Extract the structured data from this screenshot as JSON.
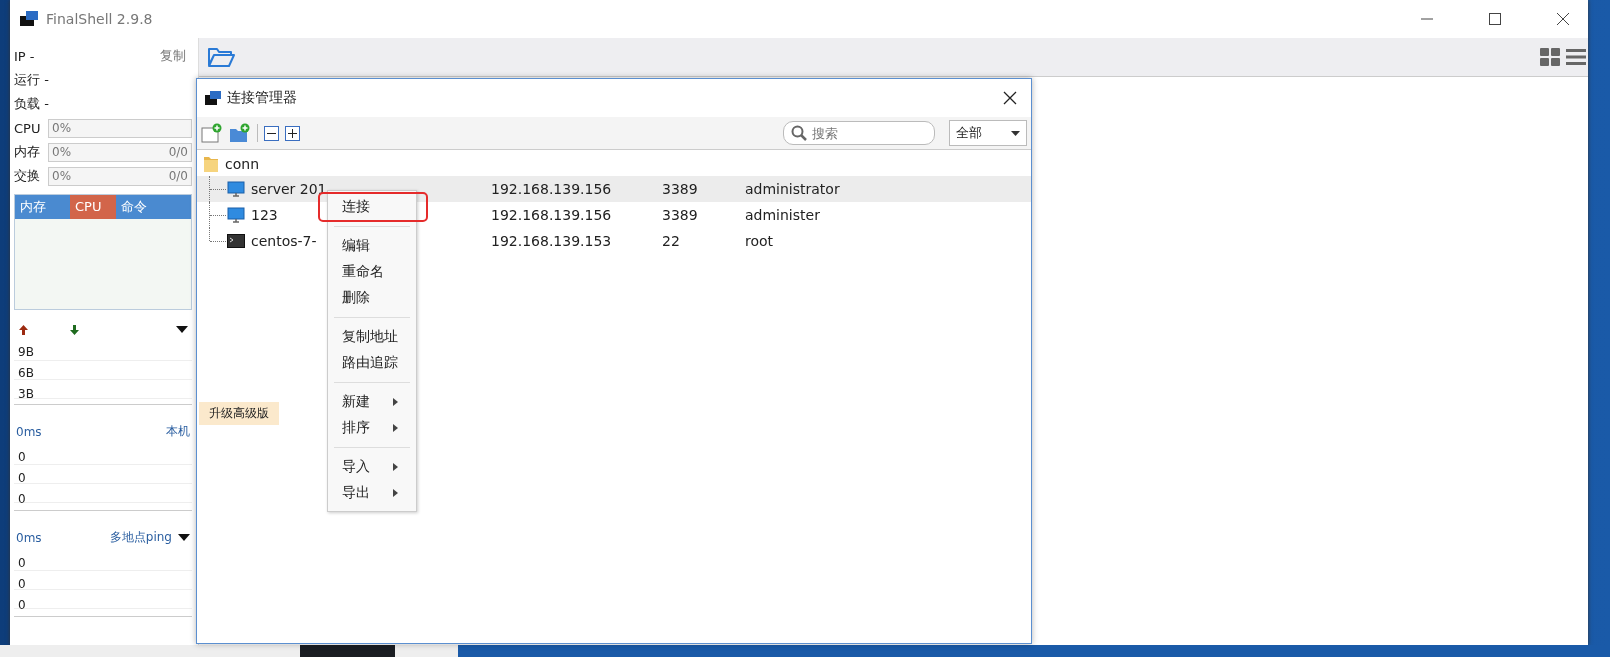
{
  "window": {
    "title": "FinalShell 2.9.8"
  },
  "sidebar": {
    "ip": {
      "text": "IP -",
      "action": "复制"
    },
    "info": [
      "运行 -",
      "负载 -"
    ],
    "meters": [
      {
        "label": "CPU",
        "value": "0%"
      },
      {
        "label": "内存",
        "value": "0%",
        "total": "0/0"
      },
      {
        "label": "交换",
        "value": "0%",
        "total": "0/0"
      }
    ],
    "tabs": [
      {
        "label": "内存",
        "selected": false
      },
      {
        "label": "CPU",
        "selected": true
      },
      {
        "label": "命令",
        "selected": false
      }
    ],
    "network": {
      "ticks": [
        "9B",
        "6B",
        "3B"
      ]
    },
    "ping": [
      {
        "latency": "0ms",
        "target": "本机",
        "dropdown": false,
        "values": [
          "0",
          "0",
          "0"
        ]
      },
      {
        "latency": "0ms",
        "target": "多地点ping",
        "dropdown": true,
        "values": [
          "0",
          "0",
          "0"
        ]
      }
    ]
  },
  "dialog": {
    "title": "连接管理器",
    "search": {
      "placeholder": "搜索"
    },
    "filter": "全部",
    "tree": {
      "name": "conn",
      "children": [
        {
          "name": "server 201",
          "kind": "desktop",
          "ip": "192.168.139.156",
          "port": "3389",
          "user": "administrator",
          "selected": true
        },
        {
          "name": "123",
          "kind": "desktop",
          "ip": "192.168.139.156",
          "port": "3389",
          "user": "administer",
          "selected": false
        },
        {
          "name": "centos-7-",
          "kind": "terminal",
          "ip": "192.168.139.153",
          "port": "22",
          "user": "root",
          "selected": false
        }
      ]
    },
    "upgrade": "升级高级版"
  },
  "context_menu": {
    "groups": [
      {
        "items": [
          {
            "label": "连接",
            "highlighted": true,
            "submenu": false
          }
        ]
      },
      {
        "items": [
          {
            "label": "编辑",
            "highlighted": false,
            "submenu": false
          },
          {
            "label": "重命名",
            "highlighted": false,
            "submenu": false
          },
          {
            "label": "删除",
            "highlighted": false,
            "submenu": false
          }
        ]
      },
      {
        "items": [
          {
            "label": "复制地址",
            "highlighted": false,
            "submenu": false
          },
          {
            "label": "路由追踪",
            "highlighted": false,
            "submenu": false
          }
        ]
      },
      {
        "items": [
          {
            "label": "新建",
            "highlighted": false,
            "submenu": true
          },
          {
            "label": "排序",
            "highlighted": false,
            "submenu": true
          }
        ]
      },
      {
        "items": [
          {
            "label": "导入",
            "highlighted": false,
            "submenu": true
          },
          {
            "label": "导出",
            "highlighted": false,
            "submenu": true
          }
        ]
      }
    ]
  }
}
